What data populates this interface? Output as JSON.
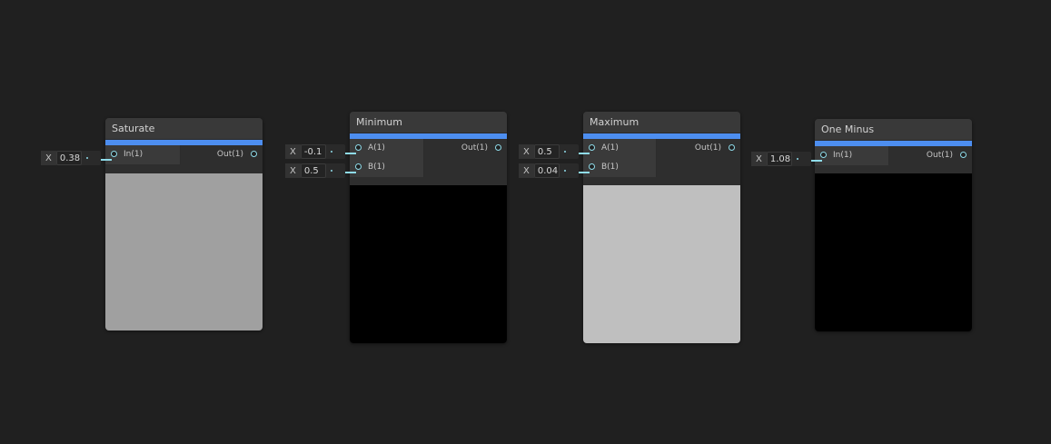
{
  "colors": {
    "background": "#202020",
    "accent": "#4d8ef0",
    "port": "#8fdcea"
  },
  "nodes": [
    {
      "title": "Saturate",
      "inputs": [
        {
          "label": "In(1)",
          "axis": "X",
          "value": "0.38"
        }
      ],
      "output": "Out(1)",
      "preview_color": "#a0a0a0"
    },
    {
      "title": "Minimum",
      "inputs": [
        {
          "label": "A(1)",
          "axis": "X",
          "value": "-0.1"
        },
        {
          "label": "B(1)",
          "axis": "X",
          "value": "0.5"
        }
      ],
      "output": "Out(1)",
      "preview_color": "#000000"
    },
    {
      "title": "Maximum",
      "inputs": [
        {
          "label": "A(1)",
          "axis": "X",
          "value": "0.5"
        },
        {
          "label": "B(1)",
          "axis": "X",
          "value": "0.04"
        }
      ],
      "output": "Out(1)",
      "preview_color": "#bfbfbf"
    },
    {
      "title": "One Minus",
      "inputs": [
        {
          "label": "In(1)",
          "axis": "X",
          "value": "1.08"
        }
      ],
      "output": "Out(1)",
      "preview_color": "#000000"
    }
  ]
}
